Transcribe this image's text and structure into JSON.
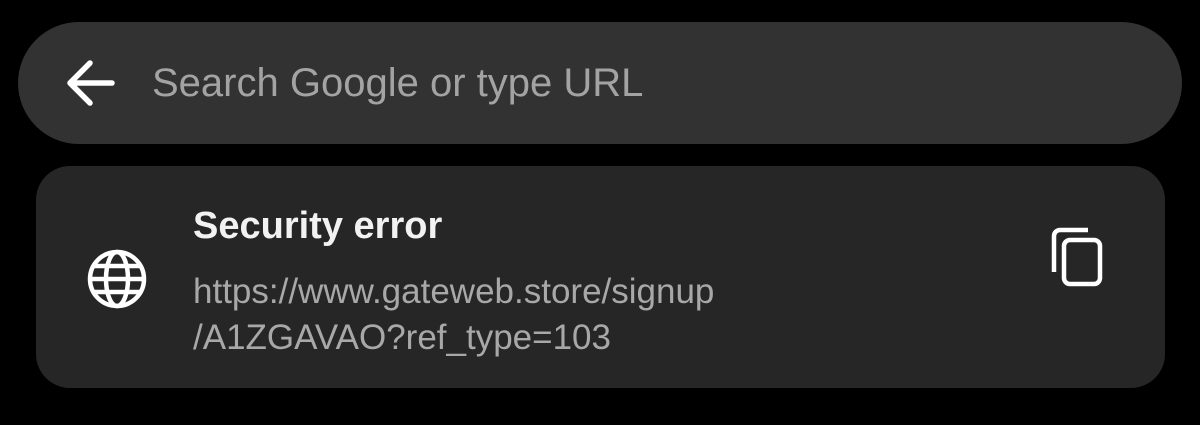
{
  "omnibox": {
    "back_icon": "arrow-left-icon",
    "placeholder": "Search Google or type URL",
    "value": ""
  },
  "suggestion": {
    "icon": "globe-icon",
    "title": "Security error",
    "url_line1": "https://www.gateweb.store/signup",
    "url_line2": "/A1ZGAVAO?ref_type=103",
    "copy_icon": "copy-icon"
  },
  "colors": {
    "background": "#000000",
    "omnibox_bg": "#323232",
    "card_bg": "#262626",
    "title_text": "#f2f2f2",
    "secondary_text": "#a8a8a8"
  }
}
